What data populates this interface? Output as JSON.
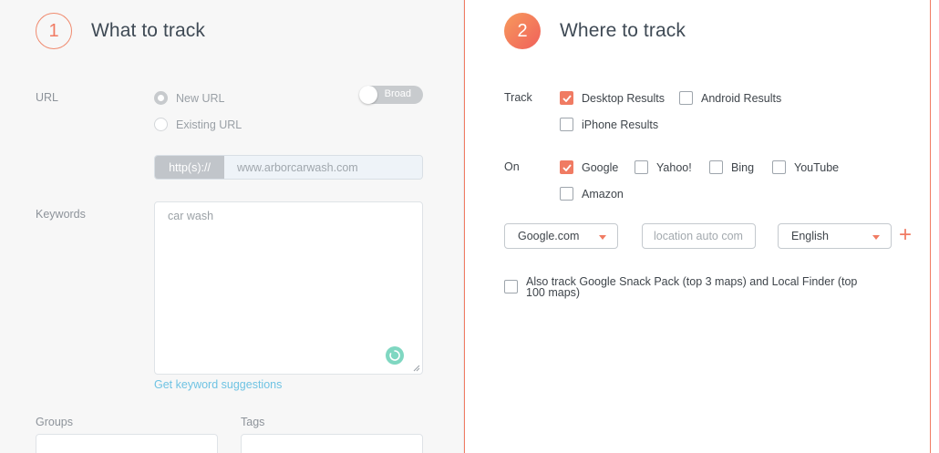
{
  "what": {
    "step_number": "1",
    "title": "What to track",
    "url_label": "URL",
    "url_options": [
      {
        "label": "New URL",
        "selected": true
      },
      {
        "label": "Existing URL",
        "selected": false
      }
    ],
    "match_toggle": {
      "label": "Broad",
      "on": false
    },
    "url_prefix": "http(s)://",
    "url_value": "www.arborcarwash.com",
    "keywords_label": "Keywords",
    "keywords_value": "car wash",
    "keyword_suggestions_link": "Get keyword suggestions",
    "groups_label": "Groups",
    "tags_label": "Tags"
  },
  "where": {
    "step_number": "2",
    "title": "Where to track",
    "track_label": "Track",
    "track_options": [
      {
        "label": "Desktop Results",
        "checked": true
      },
      {
        "label": "Android Results",
        "checked": false
      },
      {
        "label": "iPhone Results",
        "checked": false
      }
    ],
    "on_label": "On",
    "engines": [
      {
        "label": "Google",
        "checked": true
      },
      {
        "label": "Yahoo!",
        "checked": false
      },
      {
        "label": "Bing",
        "checked": false
      },
      {
        "label": "YouTube",
        "checked": false
      },
      {
        "label": "Amazon",
        "checked": false
      }
    ],
    "domain_select": "Google.com",
    "location_placeholder": "location auto com",
    "language_select": "English",
    "add_symbol": "+",
    "snack_pack_label": "Also track Google Snack Pack (top 3 maps) and Local Finder (top 100 maps)",
    "snack_pack_checked": false
  },
  "colors": {
    "accent": "#f07b63",
    "link": "#6fc3e3",
    "spinner": "#7fd7c1"
  }
}
